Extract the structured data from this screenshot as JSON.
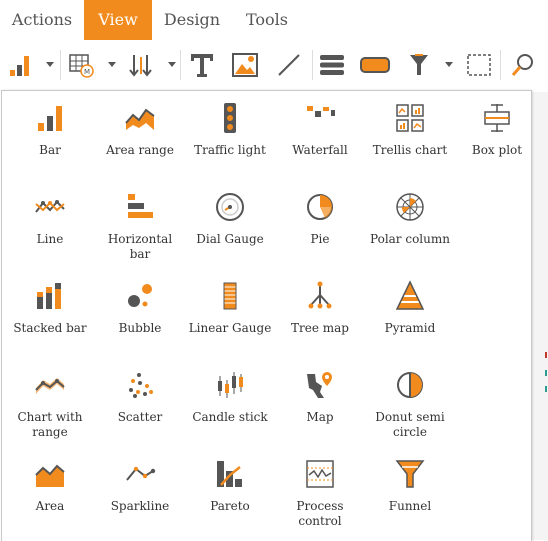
{
  "menu": {
    "tabs": [
      {
        "label": "Actions"
      },
      {
        "label": "View"
      },
      {
        "label": "Design"
      },
      {
        "label": "Tools"
      }
    ],
    "active": "View"
  },
  "toolbar": {
    "icons": [
      "chart-type-icon",
      "dropdown-caret-icon",
      "grid-map-icon",
      "dropdown-caret-icon",
      "sort-icon",
      "dropdown-caret-icon",
      "text-icon",
      "image-icon",
      "line-icon",
      "stack-icon",
      "rounded-rect-icon",
      "funnel-filter-icon",
      "dropdown-caret-icon",
      "select-region-icon",
      "zoom-icon"
    ]
  },
  "colors": {
    "accent": "#f28b1e",
    "icon_dark": "#555555",
    "panel_border": "#c8c8c8"
  },
  "chart_types": [
    [
      {
        "label": "Bar",
        "icon": "bar-chart-icon"
      },
      {
        "label": "Area range",
        "icon": "area-range-icon"
      },
      {
        "label": "Traffic light",
        "icon": "traffic-light-icon"
      },
      {
        "label": "Waterfall",
        "icon": "waterfall-icon"
      },
      {
        "label": "Trellis chart",
        "icon": "trellis-chart-icon"
      },
      {
        "label": "Box plot",
        "icon": "box-plot-icon"
      }
    ],
    [
      {
        "label": "Line",
        "icon": "line-chart-icon"
      },
      {
        "label": "Horizontal bar",
        "icon": "horizontal-bar-icon"
      },
      {
        "label": "Dial Gauge",
        "icon": "dial-gauge-icon"
      },
      {
        "label": "Pie",
        "icon": "pie-chart-icon"
      },
      {
        "label": "Polar column",
        "icon": "polar-column-icon"
      }
    ],
    [
      {
        "label": "Stacked bar",
        "icon": "stacked-bar-icon"
      },
      {
        "label": "Bubble",
        "icon": "bubble-icon"
      },
      {
        "label": "Linear Gauge",
        "icon": "linear-gauge-icon"
      },
      {
        "label": "Tree map",
        "icon": "tree-map-icon"
      },
      {
        "label": "Pyramid",
        "icon": "pyramid-icon"
      }
    ],
    [
      {
        "label": "Chart with range",
        "icon": "chart-with-range-icon"
      },
      {
        "label": "Scatter",
        "icon": "scatter-icon"
      },
      {
        "label": "Candle stick",
        "icon": "candle-stick-icon"
      },
      {
        "label": "Map",
        "icon": "map-icon"
      },
      {
        "label": "Donut semi circle",
        "icon": "donut-semi-circle-icon"
      }
    ],
    [
      {
        "label": "Area",
        "icon": "area-chart-icon"
      },
      {
        "label": "Sparkline",
        "icon": "sparkline-icon"
      },
      {
        "label": "Pareto",
        "icon": "pareto-icon"
      },
      {
        "label": "Process control",
        "icon": "process-control-icon"
      },
      {
        "label": "Funnel",
        "icon": "funnel-icon"
      }
    ]
  ]
}
